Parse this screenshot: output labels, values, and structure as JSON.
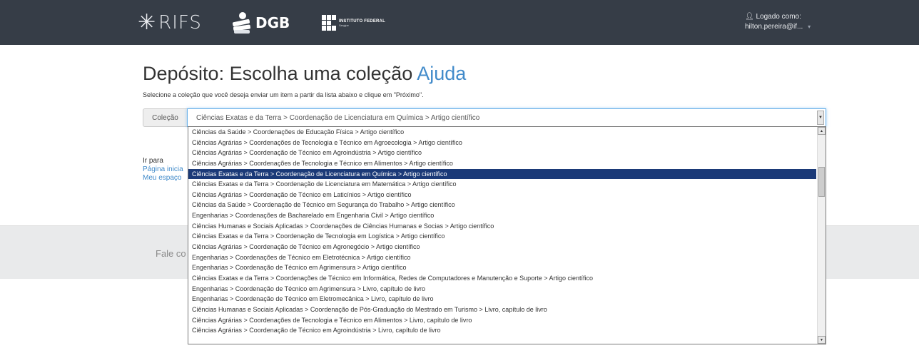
{
  "navbar": {
    "rifs_logo": "RIFS",
    "dgb_logo": "DGB",
    "if_logo": {
      "line1": "INSTITUTO FEDERAL",
      "line2": "Sergipe"
    },
    "user": {
      "label": "Logado como:",
      "name": "hilton.pereira@if..."
    },
    "icons": {
      "user": "user-icon",
      "caret": "caret-down-icon"
    }
  },
  "page": {
    "title": "Depósito: Escolha uma coleção",
    "help": "Ajuda",
    "instruction": "Selecione a coleção que você deseja enviar um item a partir da lista abaixo e clique em \"Próximo\"."
  },
  "collection": {
    "label": "Coleção",
    "selected": "Ciências Exatas e da Terra > Coordenação de Licenciatura em Química > Artigo científico",
    "options": [
      "Ciências da Saúde > Coordenações de Educação Física > Artigo científico",
      "Ciências Agrárias > Coordenações de Tecnologia e Técnico em Agroecologia > Artigo científico",
      "Ciências Agrárias > Coordenação de Técnico em Agroindústria > Artigo científico",
      "Ciências Agrárias > Coordenações de Tecnologia e Técnico em Alimentos > Artigo científico",
      "Ciências Exatas e da Terra > Coordenação de Licenciatura em Química > Artigo científico",
      "Ciências Exatas e da Terra > Coordenação de Licenciatura em Matemática > Artigo científico",
      "Ciências Agrárias > Coordenação de Técnico em Laticínios > Artigo científico",
      "Ciências da Saúde > Coordenação de Técnico em Segurança do Trabalho > Artigo científico",
      "Engenharias > Coordenações de Bacharelado em Engenharia Civil > Artigo científico",
      "Ciências Humanas e Sociais Aplicadas > Coordenações de Ciências Humanas e Socias > Artigo científico",
      "Ciências Exatas e da Terra > Coordenação de Tecnologia em Logística > Artigo científico",
      "Ciências Agrárias > Coordenação de Técnico em Agronegócio > Artigo científico",
      "Engenharias > Coordenações de Técnico em Eletrotécnica > Artigo científico",
      "Engenharias > Coordenação de Técnico em Agrimensura > Artigo científico",
      "Ciências Exatas e da Terra > Coordenações de Técnico em Informática, Redes de Computadores e Manutenção e Suporte > Artigo científico",
      "Engenharias > Coordenação de Técnico em Agrimensura > Livro, capítulo de livro",
      "Engenharias > Coordenação de Técnico em Eletromecânica > Livro, capítulo de livro",
      "Ciências Humanas e Sociais Aplicadas > Coordenação de Pós-Graduação do Mestrado em Turismo > Livro, capítulo de livro",
      "Ciências Agrárias > Coordenações de Tecnologia e Técnico em Alimentos > Livro, capítulo de livro",
      "Ciências Agrárias > Coordenação de Técnico em Agroindústria > Livro, capítulo de livro"
    ],
    "selected_index": 4
  },
  "goto": {
    "label": "Ir para",
    "links": [
      "Página inicia",
      "Meu espaço"
    ]
  },
  "footer": {
    "contact": "Fale co"
  }
}
